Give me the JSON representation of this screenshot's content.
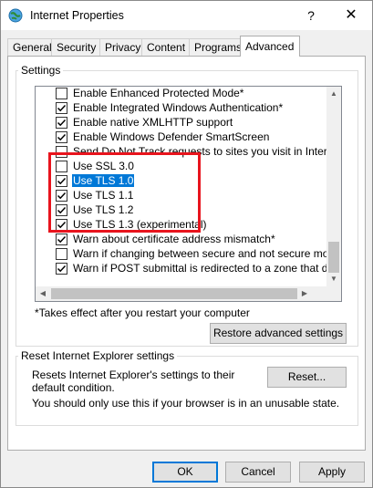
{
  "window": {
    "title": "Internet Properties",
    "help_symbol": "?",
    "close_symbol": "✕"
  },
  "tabs": [
    {
      "label": "General",
      "active": false
    },
    {
      "label": "Security",
      "active": false
    },
    {
      "label": "Privacy",
      "active": false
    },
    {
      "label": "Content",
      "active": false
    },
    {
      "label": "Programs",
      "active": false
    },
    {
      "label": "Advanced",
      "active": true
    }
  ],
  "settings": {
    "group_label": "Settings",
    "items": [
      {
        "label": "Enable Enhanced Protected Mode*",
        "checked": false,
        "selected": false
      },
      {
        "label": "Enable Integrated Windows Authentication*",
        "checked": true,
        "selected": false
      },
      {
        "label": "Enable native XMLHTTP support",
        "checked": true,
        "selected": false
      },
      {
        "label": "Enable Windows Defender SmartScreen",
        "checked": true,
        "selected": false
      },
      {
        "label": "Send Do Not Track requests to sites you visit in Internet E",
        "checked": false,
        "selected": false
      },
      {
        "label": "Use SSL 3.0",
        "checked": false,
        "selected": false
      },
      {
        "label": "Use TLS 1.0",
        "checked": true,
        "selected": true
      },
      {
        "label": "Use TLS 1.1",
        "checked": true,
        "selected": false
      },
      {
        "label": "Use TLS 1.2",
        "checked": true,
        "selected": false
      },
      {
        "label": "Use TLS 1.3 (experimental)",
        "checked": true,
        "selected": false
      },
      {
        "label": "Warn about certificate address mismatch*",
        "checked": true,
        "selected": false
      },
      {
        "label": "Warn if changing between secure and not secure mode",
        "checked": false,
        "selected": false
      },
      {
        "label": "Warn if POST submittal is redirected to a zone that does n",
        "checked": true,
        "selected": false
      }
    ],
    "note": "*Takes effect after you restart your computer",
    "restore_button": "Restore advanced settings",
    "highlight_color": "#e8141d"
  },
  "reset": {
    "group_label": "Reset Internet Explorer settings",
    "description": "Resets Internet Explorer's settings to their default condition.",
    "button": "Reset...",
    "warning": "You should only use this if your browser is in an unusable state."
  },
  "footer": {
    "ok": "OK",
    "cancel": "Cancel",
    "apply": "Apply"
  },
  "colors": {
    "selection": "#0078d7",
    "dialog_bg": "#f0f0f0"
  }
}
